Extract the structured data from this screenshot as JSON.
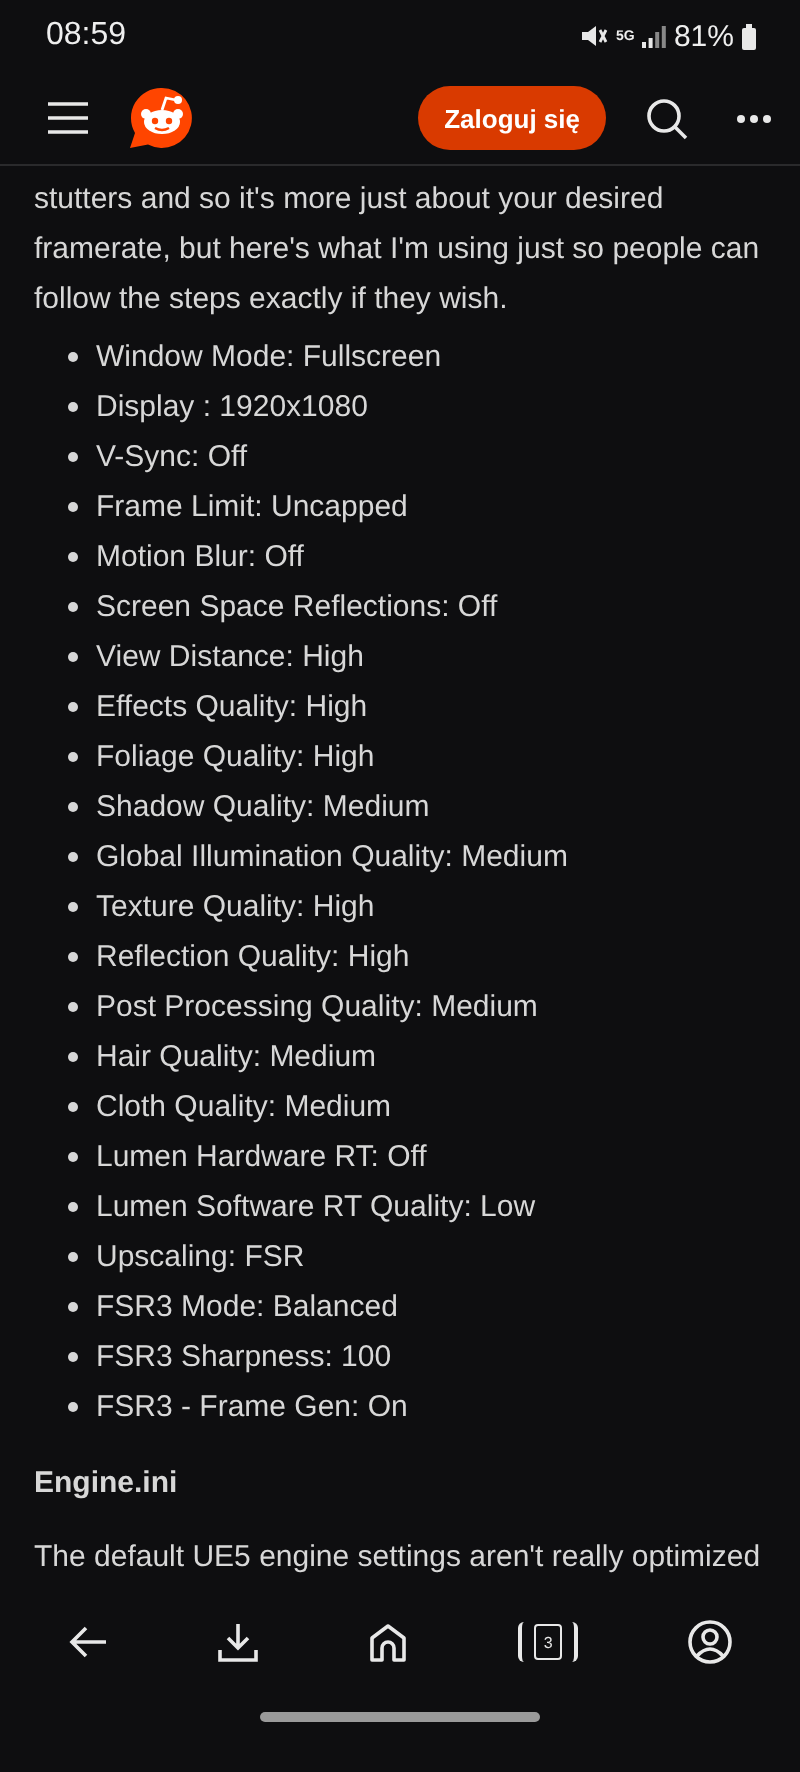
{
  "status_bar": {
    "time": "08:59",
    "network": "5G",
    "battery": "81%"
  },
  "header": {
    "login_button": "Zaloguj się"
  },
  "intro": "stutters and so it's more just about your desired framerate, but here's what I'm using just so people can follow the steps exactly if they wish.",
  "settings": [
    "Window Mode: Fullscreen",
    "Display : 1920x1080",
    "V-Sync: Off",
    "Frame Limit: Uncapped",
    "Motion Blur: Off",
    "Screen Space Reflections: Off",
    "View Distance: High",
    "Effects Quality: High",
    "Foliage Quality: High",
    "Shadow Quality: Medium",
    "Global Illumination Quality: Medium",
    "Texture Quality: High",
    "Reflection Quality: High",
    "Post Processing Quality: Medium",
    "Hair Quality: Medium",
    "Cloth Quality: Medium",
    "Lumen Hardware RT: Off",
    "Lumen Software RT Quality: Low",
    "Upscaling: FSR",
    "FSR3 Mode: Balanced",
    "FSR3 Sharpness: 100",
    "FSR3 - Frame Gen: On"
  ],
  "section_heading": "Engine.ini",
  "section_text": "The default UE5 engine settings aren't really optimized",
  "bottom_nav": {
    "tab_count": "3"
  }
}
